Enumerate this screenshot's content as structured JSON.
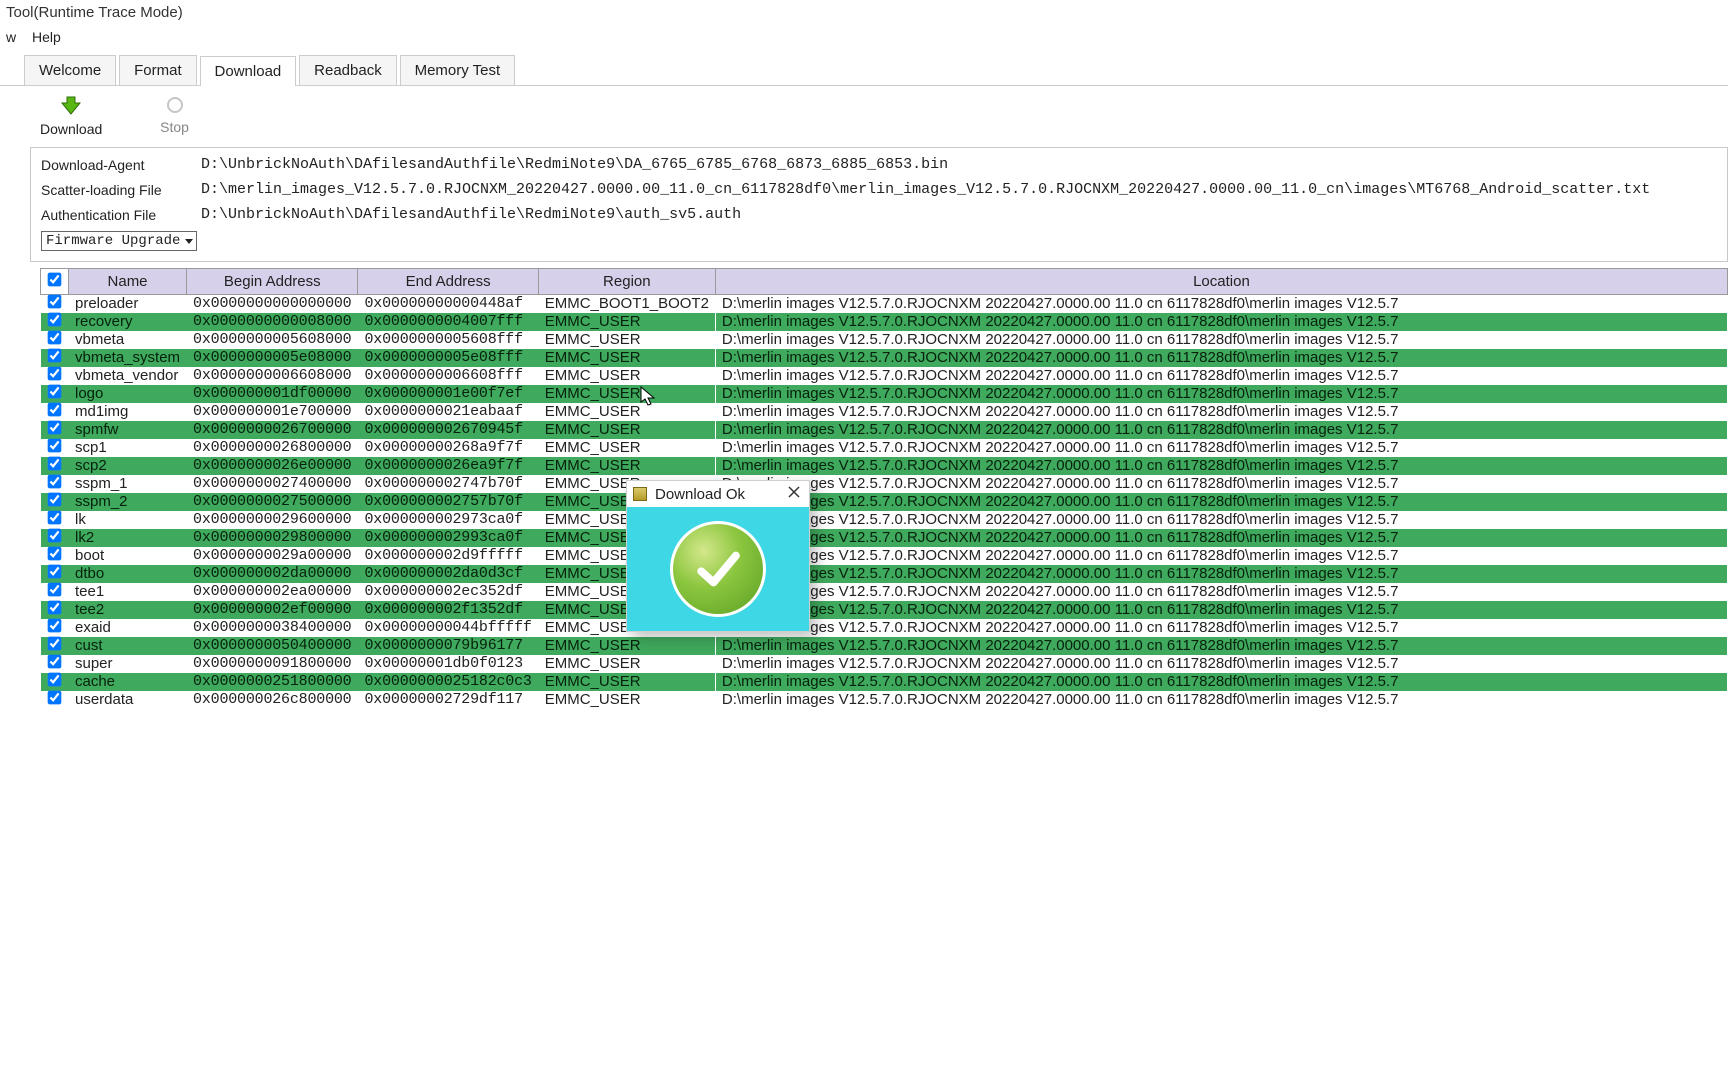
{
  "window": {
    "title": "Tool(Runtime Trace Mode)"
  },
  "menu": {
    "item1": "w",
    "item2": "Help"
  },
  "tabs": {
    "welcome": "Welcome",
    "format": "Format",
    "download": "Download",
    "readback": "Readback",
    "memtest": "Memory Test"
  },
  "toolbar": {
    "download": "Download",
    "stop": "Stop"
  },
  "form": {
    "da_label": "Download-Agent",
    "da_value": "D:\\UnbrickNoAuth\\DAfilesandAuthfile\\RedmiNote9\\DA_6765_6785_6768_6873_6885_6853.bin",
    "scatter_label": "Scatter-loading File",
    "scatter_value": "D:\\merlin_images_V12.5.7.0.RJOCNXM_20220427.0000.00_11.0_cn_6117828df0\\merlin_images_V12.5.7.0.RJOCNXM_20220427.0000.00_11.0_cn\\images\\MT6768_Android_scatter.txt",
    "auth_label": "Authentication File",
    "auth_value": "D:\\UnbrickNoAuth\\DAfilesandAuthfile\\RedmiNote9\\auth_sv5.auth",
    "mode": "Firmware Upgrade"
  },
  "columns": {
    "name": "Name",
    "begin": "Begin Address",
    "end": "End Address",
    "region": "Region",
    "location": "Location"
  },
  "loc_common": "D:\\merlin images V12.5.7.0.RJOCNXM 20220427.0000.00 11.0 cn 6117828df0\\merlin images V12.5.7",
  "loc_short": "V12.5.7.0.RJOCNXM 20220427.0000.00 11.0 cn 6117828df0\\merlin images V12.5.7",
  "rows": [
    {
      "hl": false,
      "name": "preloader",
      "begin": "0x0000000000000000",
      "end": "0x00000000000448af",
      "region": "EMMC_BOOT1_BOOT2"
    },
    {
      "hl": true,
      "name": "recovery",
      "begin": "0x0000000000008000",
      "end": "0x0000000004007fff",
      "region": "EMMC_USER"
    },
    {
      "hl": false,
      "name": "vbmeta",
      "begin": "0x0000000005608000",
      "end": "0x0000000005608fff",
      "region": "EMMC_USER"
    },
    {
      "hl": true,
      "name": "vbmeta_system",
      "begin": "0x0000000005e08000",
      "end": "0x0000000005e08fff",
      "region": "EMMC_USER"
    },
    {
      "hl": false,
      "name": "vbmeta_vendor",
      "begin": "0x0000000006608000",
      "end": "0x0000000006608fff",
      "region": "EMMC_USER"
    },
    {
      "hl": true,
      "name": "logo",
      "begin": "0x000000001df00000",
      "end": "0x000000001e00f7ef",
      "region": "EMMC_USER"
    },
    {
      "hl": false,
      "name": "md1img",
      "begin": "0x000000001e700000",
      "end": "0x0000000021eabaaf",
      "region": "EMMC_USER"
    },
    {
      "hl": true,
      "name": "spmfw",
      "begin": "0x0000000026700000",
      "end": "0x000000002670945f",
      "region": "EMMC_USER"
    },
    {
      "hl": false,
      "name": "scp1",
      "begin": "0x0000000026800000",
      "end": "0x00000000268a9f7f",
      "region": "EMMC_USER"
    },
    {
      "hl": true,
      "name": "scp2",
      "begin": "0x0000000026e00000",
      "end": "0x0000000026ea9f7f",
      "region": "EMMC_USER"
    },
    {
      "hl": false,
      "name": "sspm_1",
      "begin": "0x0000000027400000",
      "end": "0x000000002747b70f",
      "region": "EMMC_USER"
    },
    {
      "hl": true,
      "name": "sspm_2",
      "begin": "0x0000000027500000",
      "end": "0x000000002757b70f",
      "region": "EMMC_USER"
    },
    {
      "hl": false,
      "name": "lk",
      "begin": "0x0000000029600000",
      "end": "0x000000002973ca0f",
      "region": "EMMC_USER"
    },
    {
      "hl": true,
      "name": "lk2",
      "begin": "0x0000000029800000",
      "end": "0x000000002993ca0f",
      "region": "EMMC_USER"
    },
    {
      "hl": false,
      "name": "boot",
      "begin": "0x0000000029a00000",
      "end": "0x000000002d9fffff",
      "region": "EMMC_USER"
    },
    {
      "hl": true,
      "name": "dtbo",
      "begin": "0x000000002da00000",
      "end": "0x000000002da0d3cf",
      "region": "EMMC_USER"
    },
    {
      "hl": false,
      "name": "tee1",
      "begin": "0x000000002ea00000",
      "end": "0x000000002ec352df",
      "region": "EMMC_USER"
    },
    {
      "hl": true,
      "name": "tee2",
      "begin": "0x000000002ef00000",
      "end": "0x000000002f1352df",
      "region": "EMMC_USER"
    },
    {
      "hl": false,
      "name": "exaid",
      "begin": "0x0000000038400000",
      "end": "0x00000000044bfffff",
      "region": "EMMC_USER"
    },
    {
      "hl": true,
      "name": "cust",
      "begin": "0x0000000050400000",
      "end": "0x0000000079b96177",
      "region": "EMMC_USER"
    },
    {
      "hl": false,
      "name": "super",
      "begin": "0x0000000091800000",
      "end": "0x00000001db0f0123",
      "region": "EMMC_USER"
    },
    {
      "hl": true,
      "name": "cache",
      "begin": "0x0000000251800000",
      "end": "0x0000000025182c0c3",
      "region": "EMMC_USER"
    },
    {
      "hl": false,
      "name": "userdata",
      "begin": "0x000000026c800000",
      "end": "0x00000002729df117",
      "region": "EMMC_USER"
    }
  ],
  "popup": {
    "title": "Download Ok"
  }
}
